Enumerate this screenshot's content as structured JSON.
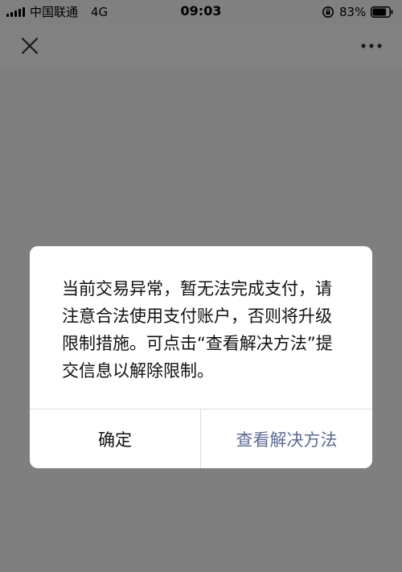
{
  "status_bar": {
    "carrier": "中国联通",
    "network": "4G",
    "time": "09:03",
    "battery": "83%",
    "battery_level": 0.83,
    "icons": [
      "signal-icon",
      "orientation-lock-icon",
      "battery-icon"
    ]
  },
  "nav_bar": {
    "icons": [
      "close-icon",
      "more-icon"
    ]
  },
  "dialog": {
    "message": "当前交易异常，暂无法完成支付，请注意合法使用支付账户，否则将升级限制措施。可点击“查看解决方法”提交信息以解除限制。",
    "confirm_label": "确定",
    "solution_label": "查看解决方法"
  },
  "colors": {
    "overlay": "#7f7f7f",
    "dialog_bg": "#ffffff",
    "primary_text": "#111111",
    "link_text": "#5b6b94"
  }
}
